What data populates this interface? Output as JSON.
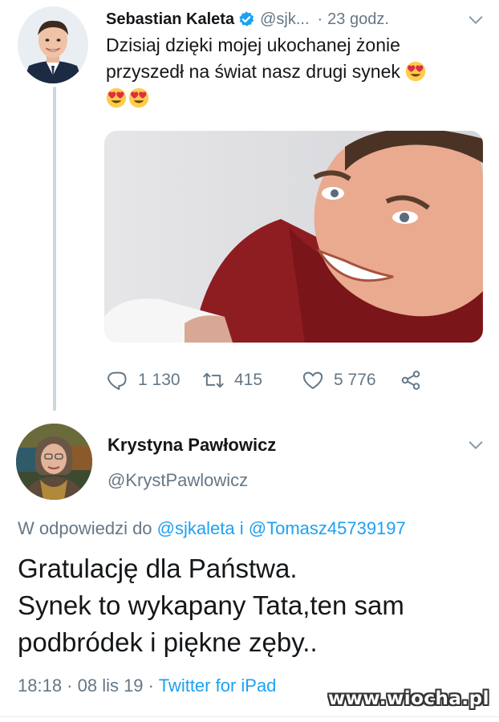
{
  "tweet": {
    "author_name": "Sebastian Kaleta",
    "handle": "@sjk...",
    "separator": "·",
    "time": "23 godz.",
    "text_line1": "Dzisiaj dzięki mojej ukochanej żonie",
    "text_line2": "przyszedł na świat nasz drugi synek",
    "verified_icon": "verified-badge-icon",
    "emoji": "heart-eyes-emoji",
    "stats": {
      "replies": "1 130",
      "retweets": "415",
      "likes": "5 776"
    }
  },
  "reply": {
    "author_name": "Krystyna Pawłowicz",
    "handle": "@KrystPawlowicz",
    "replying_prefix": "W odpowiedzi do",
    "mention1": "@sjkaleta",
    "conjunction": "i",
    "mention2": "@Tomasz45739197",
    "text_line1": "Gratulację dla Państwa.",
    "text_line2": "Synek to wykapany Tata,ten sam",
    "text_line3": "podbródek i piękne zęby..",
    "date": "18:18 · 08 lis 19 ·",
    "source": "Twitter for iPad"
  },
  "watermark": "www.wiocha.pl",
  "colors": {
    "link": "#1da1f2",
    "secondary_text": "#657786",
    "thread_line": "#ccd6dd",
    "verified": "#1da1f2"
  }
}
